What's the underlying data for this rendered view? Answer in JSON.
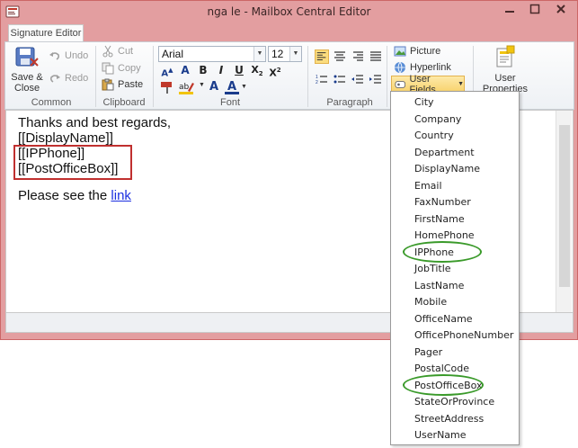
{
  "window": {
    "title": "nga le - Mailbox Central Editor"
  },
  "tabs": [
    "Signature Editor"
  ],
  "ribbon": {
    "common": {
      "label": "Common",
      "save_close": [
        "Save &",
        "Close"
      ],
      "undo": "Undo",
      "redo": "Redo"
    },
    "clipboard": {
      "label": "Clipboard",
      "cut": "Cut",
      "copy": "Copy",
      "paste": "Paste"
    },
    "font": {
      "label": "Font",
      "family": "Arial",
      "size": "12"
    },
    "paragraph": {
      "label": "Paragraph"
    },
    "insert": {
      "picture": "Picture",
      "hyperlink": "Hyperlink",
      "user_fields": "User Fields"
    },
    "properties": {
      "user_properties": "User Properties"
    }
  },
  "editor": {
    "lines": [
      "Thanks and best regards,",
      "[[DisplayName]]",
      "[[IPPhone]]",
      "[[PostOfficeBox]]"
    ],
    "see_prefix": "Please see the",
    "see_link": "link"
  },
  "user_fields_menu": [
    "City",
    "Company",
    "Country",
    "Department",
    "DisplayName",
    "Email",
    "FaxNumber",
    "FirstName",
    "HomePhone",
    "IPPhone",
    "JobTitle",
    "LastName",
    "Mobile",
    "OfficeName",
    "OfficePhoneNumber",
    "Pager",
    "PostalCode",
    "PostOfficeBox",
    "StateOrProvince",
    "StreetAddress",
    "UserName"
  ],
  "highlighted_fields": [
    "IPPhone",
    "PostOfficeBox"
  ],
  "colors": {
    "window_frame": "#e39ea0",
    "highlight_red": "#c0302f",
    "highlight_green": "#3a9a2a",
    "link": "#1a2ee0",
    "user_fields_button": "#f8d36e"
  }
}
